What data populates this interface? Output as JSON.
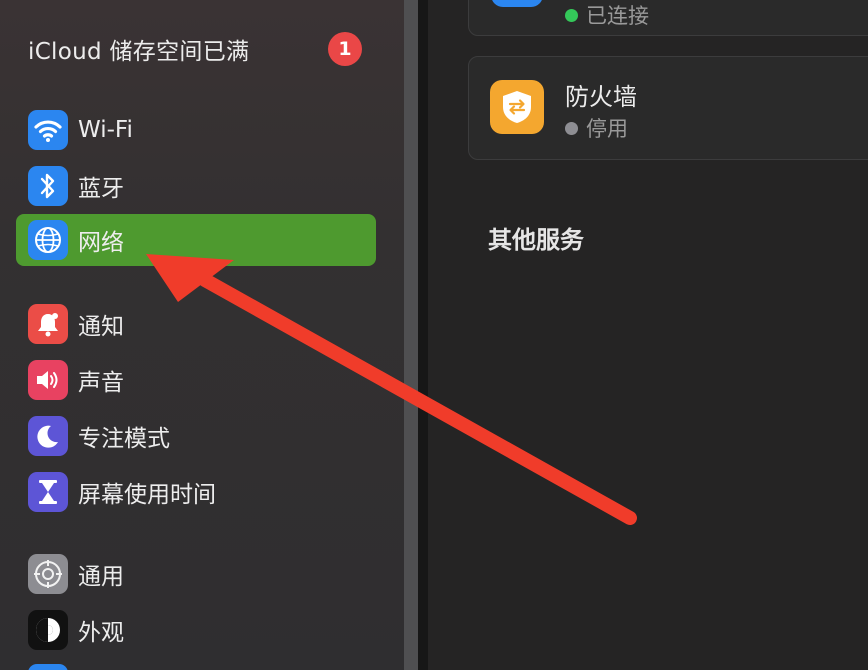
{
  "sidebar": {
    "icloud": {
      "label": "iCloud 储存空间已满",
      "badge": "1"
    },
    "items": [
      {
        "id": "wifi",
        "label": "Wi-Fi",
        "icon": "wifi-icon",
        "color": "#2b86f0"
      },
      {
        "id": "bluetooth",
        "label": "蓝牙",
        "icon": "bluetooth-icon",
        "color": "#2b86f0"
      },
      {
        "id": "network",
        "label": "网络",
        "icon": "globe-icon",
        "color": "#2b86f0",
        "selected": true
      },
      {
        "id": "notifications",
        "label": "通知",
        "icon": "bell-icon",
        "color": "#eb4d47"
      },
      {
        "id": "sound",
        "label": "声音",
        "icon": "speaker-icon",
        "color": "#e84261"
      },
      {
        "id": "focus",
        "label": "专注模式",
        "icon": "moon-icon",
        "color": "#5d55d6"
      },
      {
        "id": "screen-time",
        "label": "屏幕使用时间",
        "icon": "hourglass-icon",
        "color": "#5d55d6"
      },
      {
        "id": "general",
        "label": "通用",
        "icon": "gear-icon",
        "color": "#8d8d92"
      },
      {
        "id": "appearance",
        "label": "外观",
        "icon": "appearance-icon",
        "color": "#111111"
      }
    ],
    "selected_color": "#4e9a2f"
  },
  "main": {
    "vpn_card": {
      "status": "已连接",
      "status_color": "#34c759"
    },
    "firewall_card": {
      "title": "防火墙",
      "status": "停用",
      "status_color": "#8e8e93",
      "icon_color": "#f4a72f"
    },
    "section_title": "其他服务"
  },
  "annotation": {
    "arrow_color": "#f03c2a"
  }
}
